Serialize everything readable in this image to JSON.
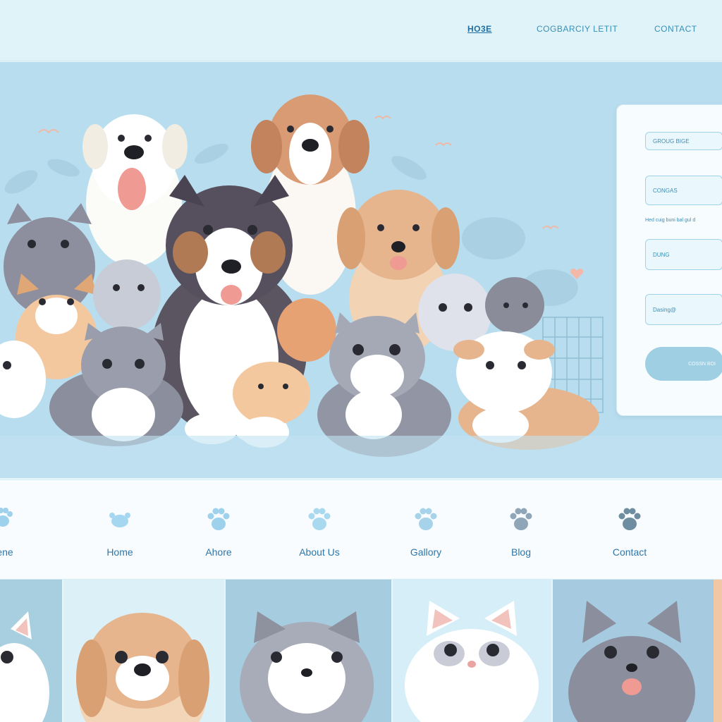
{
  "header": {
    "nav": [
      {
        "label": "HO3E",
        "active": true
      },
      {
        "label": "COGBARCIY LETIT",
        "active": false
      },
      {
        "label": "CONTACT",
        "active": false
      }
    ]
  },
  "form": {
    "field1_value": "GROUG BIGE",
    "field2_value": "CONGAS",
    "note": "Hed cuig buni bal gul d",
    "field3_value": "DUNG",
    "field4_value": "Dasing@",
    "submit_label": "COSSN BOI"
  },
  "icon_nav": {
    "items": [
      {
        "label": "ene",
        "icon": "paw-icon"
      },
      {
        "label": "Home",
        "icon": "paw-icon"
      },
      {
        "label": "Ahore",
        "icon": "paw-icon"
      },
      {
        "label": "About Us",
        "icon": "paw-icon"
      },
      {
        "label": "Gallory",
        "icon": "paw-icon"
      },
      {
        "label": "Blog",
        "icon": "paw-icon"
      },
      {
        "label": "Contact",
        "icon": "paw-icon"
      }
    ]
  },
  "colors": {
    "page_bg": "#e6f6fb",
    "hero_bg": "#b8ddee",
    "accent": "#2f76a8",
    "field_border": "#9fd3ea"
  }
}
